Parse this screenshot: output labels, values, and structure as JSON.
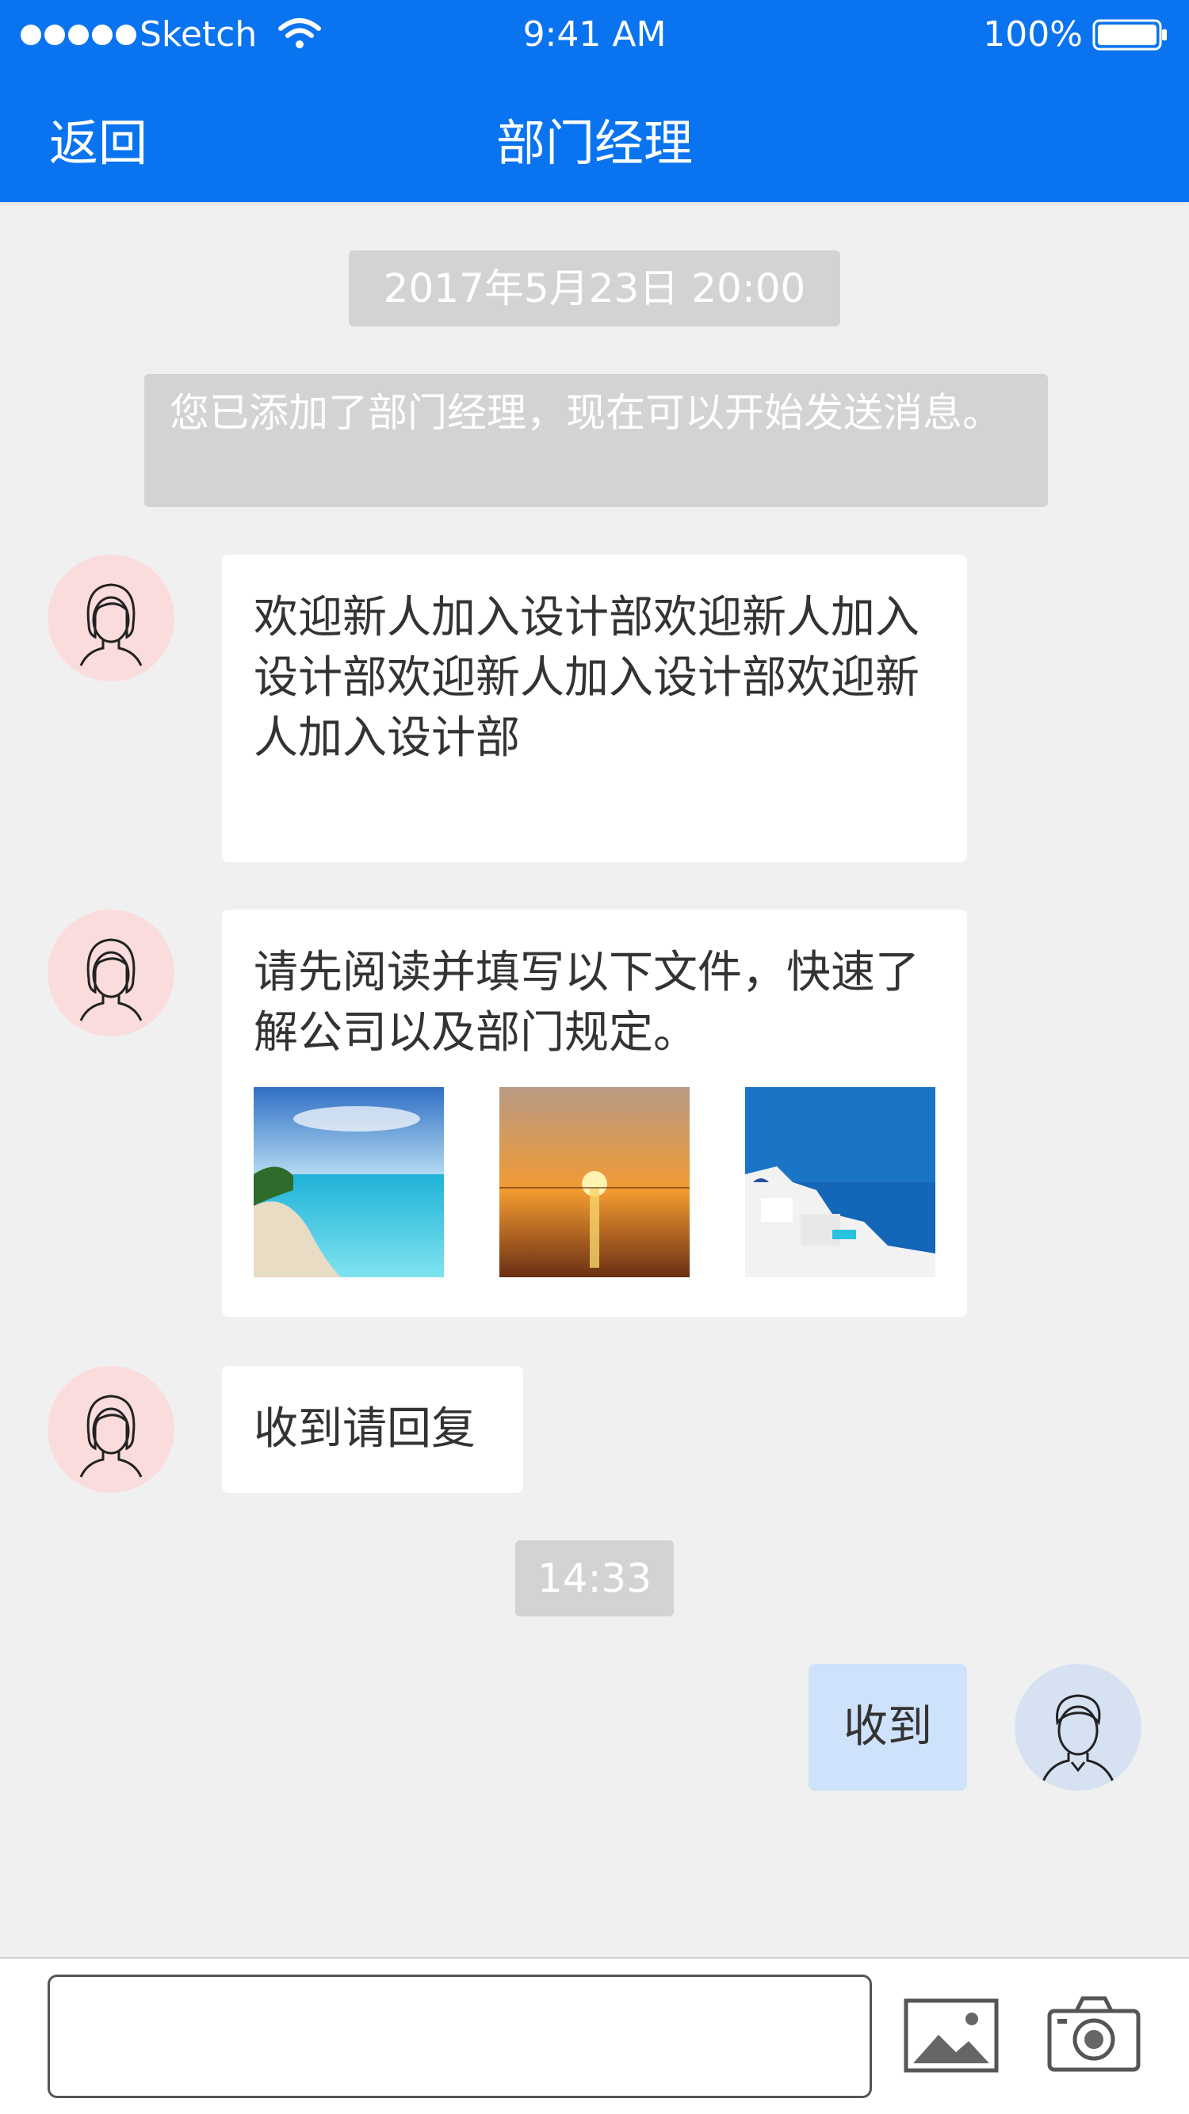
{
  "status_bar": {
    "carrier": "Sketch",
    "time": "9:41 AM",
    "battery": "100%",
    "icons": [
      "signal-dots-icon",
      "wifi-icon",
      "battery-icon"
    ]
  },
  "nav": {
    "back_label": "返回",
    "title": "部门经理"
  },
  "chat": {
    "timestamp_1": "2017年5月23日 20:00",
    "system_notice": "您已添加了部门经理，现在可以开始发送消息。",
    "messages": [
      {
        "sender": "other",
        "text": "欢迎新人加入设计部欢迎新人加入设计部欢迎新人加入设计部欢迎新人加入设计部"
      },
      {
        "sender": "other",
        "text": "请先阅读并填写以下文件，快速了解公司以及部门规定。",
        "images": [
          "beach-photo",
          "sunset-photo",
          "santorini-photo"
        ]
      },
      {
        "sender": "other",
        "text": "收到请回复"
      },
      {
        "sender": "me",
        "text": "收到"
      }
    ],
    "timestamp_2": "14:33"
  },
  "input_bar": {
    "value": "",
    "icons": [
      "image-icon",
      "camera-icon"
    ]
  },
  "colors": {
    "nav_bg": "#0a74f0",
    "chat_bg": "#f0f0f0",
    "other_avatar_bg": "#fbdcdc",
    "me_avatar_bg": "#d6e1f2",
    "me_bubble": "#cfe2fb",
    "system_pill": "#d3d3d3"
  }
}
